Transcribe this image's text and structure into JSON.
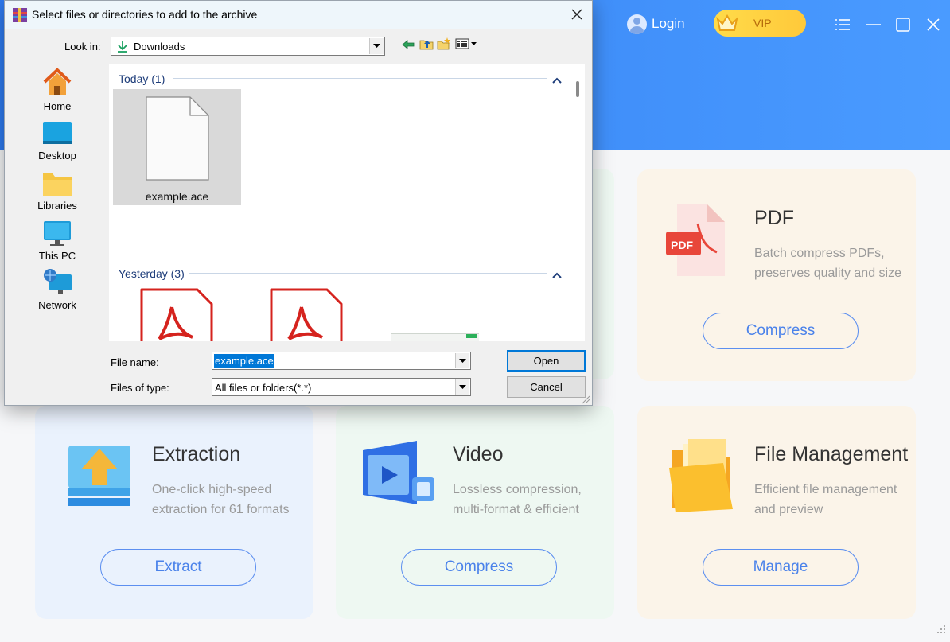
{
  "header": {
    "login_label": "Login",
    "vip_label": "VIP",
    "colors": {
      "header_blue": "#2f7bf1",
      "accent": "#4a82ea",
      "vip_gold": "#ffd33d"
    }
  },
  "cards": {
    "pdf": {
      "title": "PDF",
      "desc_line1": "Batch compress PDFs,",
      "desc_line2": "preserves quality and size",
      "button": "Compress",
      "icon": "pdf-file-icon"
    },
    "extraction": {
      "title": "Extraction",
      "desc_line1": "One-click high-speed",
      "desc_line2": "extraction for 61 formats",
      "button": "Extract",
      "icon": "extract-upload-icon"
    },
    "video": {
      "title": "Video",
      "desc_line1": "Lossless compression,",
      "desc_line2": "multi-format & efficient",
      "button": "Compress",
      "icon": "video-play-icon"
    },
    "file_management": {
      "title": "File Management",
      "desc_line1": "Efficient file management",
      "desc_line2": "and preview",
      "button": "Manage",
      "icon": "folder-icon"
    }
  },
  "dialog": {
    "title": "Select files or directories to add to the archive",
    "look_in_label": "Look in:",
    "look_in_value": "Downloads",
    "places": [
      "Home",
      "Desktop",
      "Libraries",
      "This PC",
      "Network"
    ],
    "groups": [
      {
        "header": "Today (1)",
        "files": [
          "example.ace"
        ]
      },
      {
        "header": "Yesterday (3)",
        "files": []
      }
    ],
    "file_name_label": "File name:",
    "file_name_value": "example.ace",
    "file_type_label": "Files of type:",
    "file_type_value": "All files or folders(*.*)",
    "open_label": "Open",
    "cancel_label": "Cancel"
  }
}
